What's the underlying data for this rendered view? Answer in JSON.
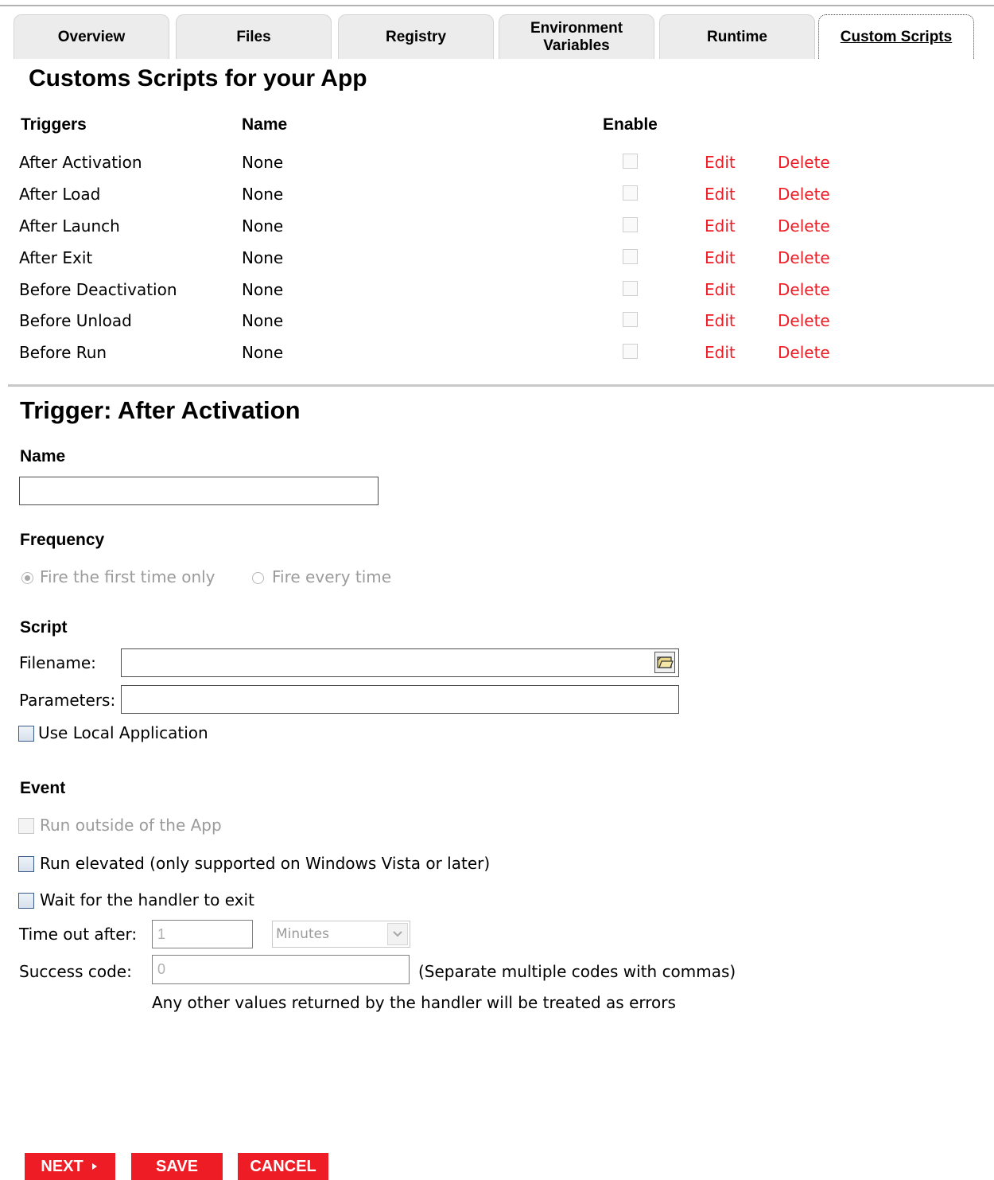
{
  "tabs": [
    {
      "label": "Overview",
      "underline_char": "w"
    },
    {
      "label": "Files",
      "underline_char": "i"
    },
    {
      "label": "Registry",
      "underline_char": "R"
    },
    {
      "label": "Environment Variables",
      "underline_char": "E"
    },
    {
      "label": "Runtime",
      "underline_char": "u"
    },
    {
      "label": "Custom Scripts",
      "underline_char": "C",
      "active": true
    }
  ],
  "page_title": "Customs Scripts for your App",
  "table": {
    "headers": {
      "triggers": "Triggers",
      "name": "Name",
      "enable": "Enable"
    },
    "rows": [
      {
        "trigger": "After Activation",
        "name": "None",
        "enabled": false,
        "edit": "Edit",
        "delete": "Delete"
      },
      {
        "trigger": "After Load",
        "name": "None",
        "enabled": false,
        "edit": "Edit",
        "delete": "Delete"
      },
      {
        "trigger": "After Launch",
        "name": "None",
        "enabled": false,
        "edit": "Edit",
        "delete": "Delete"
      },
      {
        "trigger": "After Exit",
        "name": "None",
        "enabled": false,
        "edit": "Edit",
        "delete": "Delete"
      },
      {
        "trigger": "Before Deactivation",
        "name": "None",
        "enabled": false,
        "edit": "Edit",
        "delete": "Delete"
      },
      {
        "trigger": "Before Unload",
        "name": "None",
        "enabled": false,
        "edit": "Edit",
        "delete": "Delete"
      },
      {
        "trigger": "Before Run",
        "name": "None",
        "enabled": false,
        "edit": "Edit",
        "delete": "Delete"
      }
    ]
  },
  "trigger_section": {
    "title": "Trigger:  After Activation",
    "name_label": "Name",
    "name_value": "",
    "frequency_label": "Frequency",
    "frequency_options": [
      "Fire the first time only",
      "Fire every time"
    ],
    "frequency_selected": "Fire the first time only",
    "script_label": "Script",
    "filename_label": "Filename:",
    "filename_value": "",
    "parameters_label": "Parameters:",
    "parameters_value": "",
    "use_local_app_label": "Use Local Application",
    "event_label": "Event",
    "run_outside_label": "Run outside of the App",
    "run_elevated_label": "Run elevated (only supported on Windows Vista or later)",
    "wait_label": "Wait for the handler to exit",
    "timeout_label": "Time out after:",
    "timeout_value": "1",
    "timeout_unit": "Minutes",
    "success_label": "Success code:",
    "success_value": "0",
    "success_hint": "(Separate multiple codes with commas)",
    "errors_note": "Any other values returned by the handler will be treated as errors"
  },
  "buttons": {
    "next": "NEXT",
    "save": "SAVE",
    "cancel": "CANCEL"
  },
  "icons": {
    "browse": "folder-open-icon",
    "next_arrow": "play-triangle-icon",
    "select_arrow": "chevron-down-icon"
  },
  "colors": {
    "accent_red": "#ee1c25",
    "tab_bg": "#ececec"
  }
}
